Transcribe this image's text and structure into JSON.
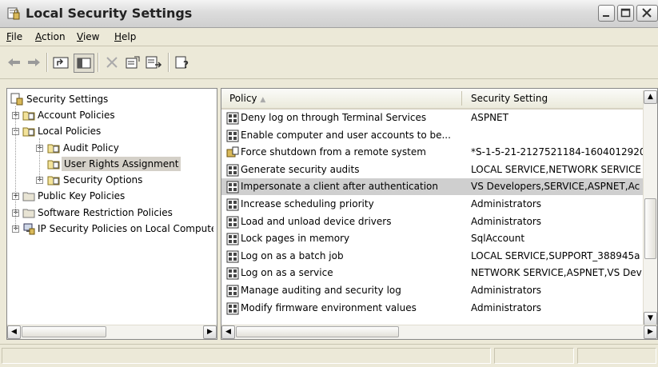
{
  "window": {
    "title": "Local Security Settings"
  },
  "menu": [
    {
      "label": "File",
      "key": "F",
      "rest": "ile"
    },
    {
      "label": "Action",
      "key": "A",
      "rest": "ction"
    },
    {
      "label": "View",
      "key": "V",
      "rest": "iew"
    },
    {
      "label": "Help",
      "key": "H",
      "rest": "elp"
    }
  ],
  "tree": {
    "root": "Security Settings",
    "account_policies": "Account Policies",
    "local_policies": "Local Policies",
    "audit_policy": "Audit Policy",
    "user_rights": "User Rights Assignment",
    "security_options": "Security Options",
    "public_key": "Public Key Policies",
    "software_restriction": "Software Restriction Policies",
    "ip_security": "IP Security Policies on Local Computer"
  },
  "list": {
    "col_policy": "Policy",
    "col_setting": "Security Setting",
    "rows": [
      {
        "policy": "Deny log on through Terminal Services",
        "setting": "ASPNET"
      },
      {
        "policy": "Enable computer and user accounts to be...",
        "setting": ""
      },
      {
        "policy": "Force shutdown from a remote system",
        "setting": "*S-1-5-21-2127521184-1604012920"
      },
      {
        "policy": "Generate security audits",
        "setting": "LOCAL SERVICE,NETWORK SERVICE"
      },
      {
        "policy": "Impersonate a client after authentication",
        "setting": "VS Developers,SERVICE,ASPNET,Ac"
      },
      {
        "policy": "Increase scheduling priority",
        "setting": "Administrators"
      },
      {
        "policy": "Load and unload device drivers",
        "setting": "Administrators"
      },
      {
        "policy": "Lock pages in memory",
        "setting": "SqlAccount"
      },
      {
        "policy": "Log on as a batch job",
        "setting": "LOCAL SERVICE,SUPPORT_388945a"
      },
      {
        "policy": "Log on as a service",
        "setting": "NETWORK SERVICE,ASPNET,VS Dev"
      },
      {
        "policy": "Manage auditing and security log",
        "setting": "Administrators"
      },
      {
        "policy": "Modify firmware environment values",
        "setting": "Administrators"
      }
    ],
    "selected_index": 4
  },
  "colors": {
    "selection": "#cfcfcf",
    "chrome": "#ece9d8",
    "border": "#888888"
  }
}
